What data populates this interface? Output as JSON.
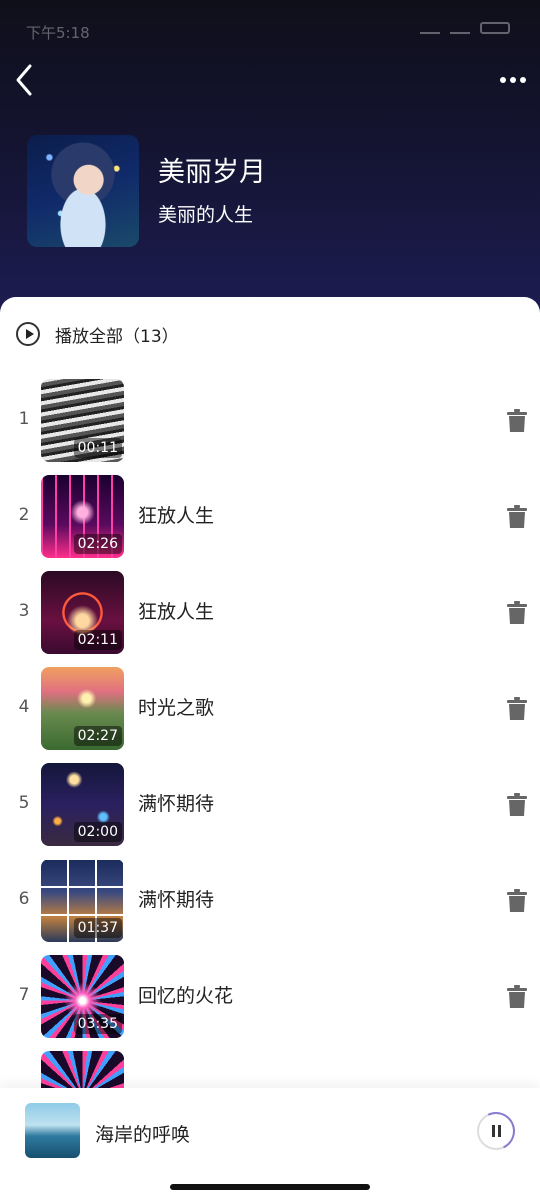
{
  "status": {
    "time": "下午5:18"
  },
  "album": {
    "title": "美丽岁月",
    "subtitle": "美丽的人生"
  },
  "play_all": {
    "label": "播放全部（13）"
  },
  "tracks": [
    {
      "num": "1",
      "title": "",
      "duration": "00:11"
    },
    {
      "num": "2",
      "title": "狂放人生",
      "duration": "02:26"
    },
    {
      "num": "3",
      "title": "狂放人生",
      "duration": "02:11"
    },
    {
      "num": "4",
      "title": "时光之歌",
      "duration": "02:27"
    },
    {
      "num": "5",
      "title": "满怀期待",
      "duration": "02:00"
    },
    {
      "num": "6",
      "title": "满怀期待",
      "duration": "01:37"
    },
    {
      "num": "7",
      "title": "回忆的火花",
      "duration": "03:35"
    }
  ],
  "now_playing": {
    "title": "海岸的呼唤"
  },
  "colors": {
    "accent": "#8a7bd0",
    "header_dark": "#0f0f1a",
    "header_light": "#1d1d55"
  }
}
